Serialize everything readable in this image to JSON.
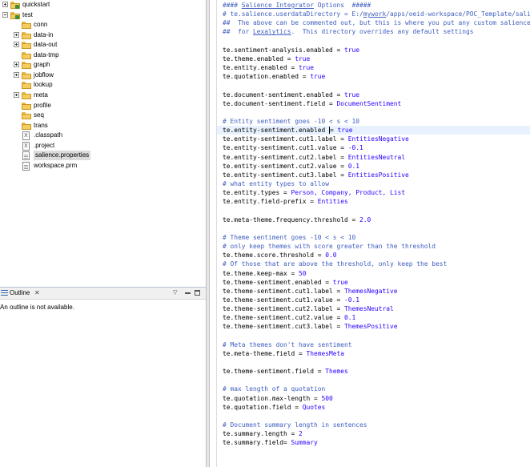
{
  "tree": {
    "items": [
      {
        "label": "quickstart",
        "kind": "project",
        "expand": "plus",
        "selected": false
      },
      {
        "label": "test",
        "kind": "project",
        "expand": "minus",
        "selected": false
      },
      {
        "label": "conn",
        "kind": "folder",
        "expand": "",
        "selected": false
      },
      {
        "label": "data-in",
        "kind": "folder",
        "expand": "plus",
        "selected": false
      },
      {
        "label": "data-out",
        "kind": "folder",
        "expand": "plus",
        "selected": false
      },
      {
        "label": "data-tmp",
        "kind": "folder",
        "expand": "",
        "selected": false
      },
      {
        "label": "graph",
        "kind": "folder",
        "expand": "plus",
        "selected": false
      },
      {
        "label": "jobflow",
        "kind": "folder",
        "expand": "plus",
        "selected": false
      },
      {
        "label": "lookup",
        "kind": "folder",
        "expand": "",
        "selected": false
      },
      {
        "label": "meta",
        "kind": "folder",
        "expand": "plus",
        "selected": false
      },
      {
        "label": "profile",
        "kind": "folder",
        "expand": "",
        "selected": false
      },
      {
        "label": "seq",
        "kind": "folder",
        "expand": "",
        "selected": false
      },
      {
        "label": "trans",
        "kind": "folder",
        "expand": "",
        "selected": false
      },
      {
        "label": ".classpath",
        "kind": "xfile",
        "expand": "",
        "selected": false
      },
      {
        "label": ".project",
        "kind": "xfile",
        "expand": "",
        "selected": false
      },
      {
        "label": "salience.properties",
        "kind": "file",
        "expand": "",
        "selected": true
      },
      {
        "label": "workspace.prm",
        "kind": "file",
        "expand": "",
        "selected": false
      }
    ]
  },
  "outline": {
    "title": "Outline",
    "close": "✕",
    "view_menu": "▽",
    "message": "An outline is not available."
  },
  "editor": {
    "lines": [
      {
        "t": "c",
        "text": "#### Salience Integrator Options  #####",
        "ul": "Salience Integrator"
      },
      {
        "t": "c",
        "text": "# te.salience.userdataDirectory = E:/mywork/apps/oeid-workspace/POC_Template/salience",
        "ul": "mywork"
      },
      {
        "t": "c",
        "text": "##  The above can be commented out, but this is where you put any custom salience data files"
      },
      {
        "t": "c",
        "text": "##  for Lexalytics.  This directory overrides any default settings",
        "ul": "Lexalytics"
      },
      {
        "t": "blank"
      },
      {
        "t": "kv",
        "k": "te.sentiment-analysis.enabled = ",
        "v": "true"
      },
      {
        "t": "kv",
        "k": "te.theme.enabled = ",
        "v": "true"
      },
      {
        "t": "kv",
        "k": "te.entity.enabled = ",
        "v": "true"
      },
      {
        "t": "kv",
        "k": "te.quotation.enabled = ",
        "v": "true"
      },
      {
        "t": "blank"
      },
      {
        "t": "kv",
        "k": "te.document-sentiment.enabled = ",
        "v": "true"
      },
      {
        "t": "kv",
        "k": "te.document-sentiment.field = ",
        "v": "DocumentSentiment"
      },
      {
        "t": "blank"
      },
      {
        "t": "c",
        "text": "# Entity sentiment goes -10 < s < 10"
      },
      {
        "t": "kv",
        "k": "te.entity-sentiment.enabled ",
        "v": "= true",
        "current": true
      },
      {
        "t": "kv",
        "k": "te.entity-sentiment.cut1.label = ",
        "v": "EntitiesNegative"
      },
      {
        "t": "kv",
        "k": "te.entity-sentiment.cut1.value = ",
        "v": "-0.1"
      },
      {
        "t": "kv",
        "k": "te.entity-sentiment.cut2.label = ",
        "v": "EntitiesNeutral"
      },
      {
        "t": "kv",
        "k": "te.entity-sentiment.cut2.value = ",
        "v": "0.1"
      },
      {
        "t": "kv",
        "k": "te.entity-sentiment.cut3.label = ",
        "v": "EntitiesPositive"
      },
      {
        "t": "c",
        "text": "# what entity types to allow"
      },
      {
        "t": "kv",
        "k": "te.entity.types = ",
        "v": "Person, Company, Product, List"
      },
      {
        "t": "kv",
        "k": "te.entity.field-prefix = ",
        "v": "Entities"
      },
      {
        "t": "blank"
      },
      {
        "t": "kv",
        "k": "te.meta-theme.frequency.threshold = ",
        "v": "2.0"
      },
      {
        "t": "blank"
      },
      {
        "t": "c",
        "text": "# Theme sentiment goes -10 < s < 10"
      },
      {
        "t": "c",
        "text": "# only keep themes with score greater than the threshold"
      },
      {
        "t": "kv",
        "k": "te.theme.score.threshold = ",
        "v": "0.0"
      },
      {
        "t": "c",
        "text": "# Of those that are above the threshold, only keep the best"
      },
      {
        "t": "kv",
        "k": "te.theme.keep-max = ",
        "v": "50"
      },
      {
        "t": "kv",
        "k": "te.theme-sentiment.enabled = ",
        "v": "true"
      },
      {
        "t": "kv",
        "k": "te.theme-sentiment.cut1.label = ",
        "v": "ThemesNegative"
      },
      {
        "t": "kv",
        "k": "te.theme-sentiment.cut1.value = ",
        "v": "-0.1"
      },
      {
        "t": "kv",
        "k": "te.theme-sentiment.cut2.label = ",
        "v": "ThemesNeutral"
      },
      {
        "t": "kv",
        "k": "te.theme-sentiment.cut2.value = ",
        "v": "0.1"
      },
      {
        "t": "kv",
        "k": "te.theme-sentiment.cut3.label = ",
        "v": "ThemesPositive"
      },
      {
        "t": "blank"
      },
      {
        "t": "c",
        "text": "# Meta themes don't have sentiment"
      },
      {
        "t": "kv",
        "k": "te.meta-theme.field = ",
        "v": "ThemesMeta"
      },
      {
        "t": "blank"
      },
      {
        "t": "kv",
        "k": "te.theme-sentiment.field = ",
        "v": "Themes"
      },
      {
        "t": "blank"
      },
      {
        "t": "c",
        "text": "# max length of a quotation"
      },
      {
        "t": "kv",
        "k": "te.quotation.max-length = ",
        "v": "500"
      },
      {
        "t": "kv",
        "k": "te.quotation.field = ",
        "v": "Quotes"
      },
      {
        "t": "blank"
      },
      {
        "t": "c",
        "text": "# Document summary length in sentences"
      },
      {
        "t": "kv",
        "k": "te.summary.length = ",
        "v": "2"
      },
      {
        "t": "kv",
        "k": "te.summary.field= ",
        "v": "Summary"
      }
    ]
  },
  "colors": {
    "comment": "#3f5fbf",
    "key": "#000000",
    "value": "#2a00ff",
    "current_line": "#e8f2fe",
    "selection": "#dcdcdc"
  }
}
